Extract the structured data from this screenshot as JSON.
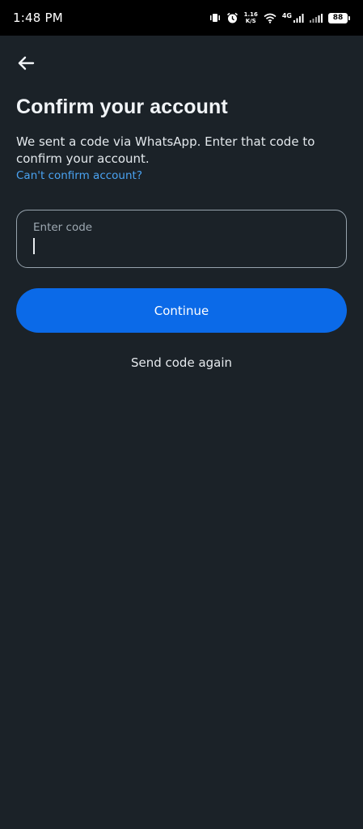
{
  "status_bar": {
    "time": "1:48 PM",
    "net_speed_value": "1.16",
    "net_speed_unit": "K/S",
    "network_type": "4G",
    "battery_level": "88",
    "icons": [
      "vibrate-icon",
      "alarm-icon",
      "wifi-icon",
      "signal-icon",
      "signal-icon",
      "battery-icon"
    ]
  },
  "header": {
    "back_icon": "arrow-left-icon"
  },
  "main": {
    "title": "Confirm your account",
    "description": "We sent a code via WhatsApp. Enter that code to confirm your account.",
    "help_link": "Can't confirm account?",
    "code_field": {
      "label": "Enter code",
      "value": ""
    },
    "continue_label": "Continue",
    "resend_label": "Send code again"
  },
  "colors": {
    "background": "#1b2228",
    "primary": "#0b6ae8",
    "link": "#4aa3f2",
    "field_border": "#97a3ad"
  }
}
